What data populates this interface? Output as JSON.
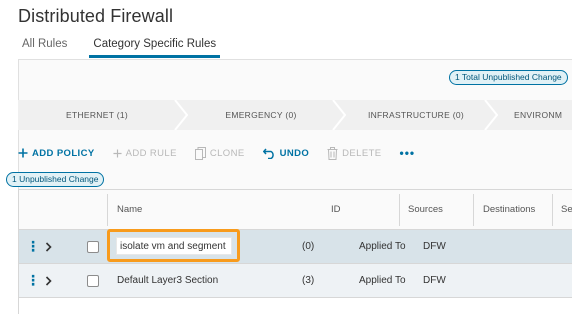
{
  "page": {
    "title": "Distributed Firewall"
  },
  "tabs": [
    {
      "label": "All Rules",
      "active": false
    },
    {
      "label": "Category Specific Rules",
      "active": true
    }
  ],
  "badges": {
    "total_unpublished": "1 Total Unpublished Change",
    "unpublished": "1 Unpublished Change"
  },
  "categories": [
    {
      "label": "ETHERNET (1)"
    },
    {
      "label": "EMERGENCY (0)"
    },
    {
      "label": "INFRASTRUCTURE (0)"
    },
    {
      "label": "ENVIRONM"
    }
  ],
  "toolbar": {
    "add_policy": {
      "label": "ADD POLICY",
      "icon": "plus-icon",
      "enabled": true
    },
    "add_rule": {
      "label": "ADD RULE",
      "icon": "plus-icon",
      "enabled": false
    },
    "clone": {
      "label": "CLONE",
      "icon": "copy-icon",
      "enabled": false
    },
    "undo": {
      "label": "UNDO",
      "icon": "undo-icon",
      "enabled": true
    },
    "delete": {
      "label": "DELETE",
      "icon": "trash-icon",
      "enabled": false
    },
    "more": {
      "label": "•••",
      "icon": "more-icon"
    }
  },
  "table": {
    "columns": [
      "Name",
      "ID",
      "Sources",
      "Destinations",
      "Se"
    ],
    "rows": [
      {
        "name": "isolate vm and segment",
        "id": "(0)",
        "applied_to_label": "Applied To",
        "applied_to": "DFW",
        "selected": true,
        "editing": true
      },
      {
        "name": "Default Layer3 Section",
        "id": "(3)",
        "applied_to_label": "Applied To",
        "applied_to": "DFW",
        "selected": false,
        "editing": false
      }
    ]
  },
  "colors": {
    "accent": "#0072a3",
    "highlight": "#f89b1c",
    "selected_row": "#d8e3e9"
  }
}
